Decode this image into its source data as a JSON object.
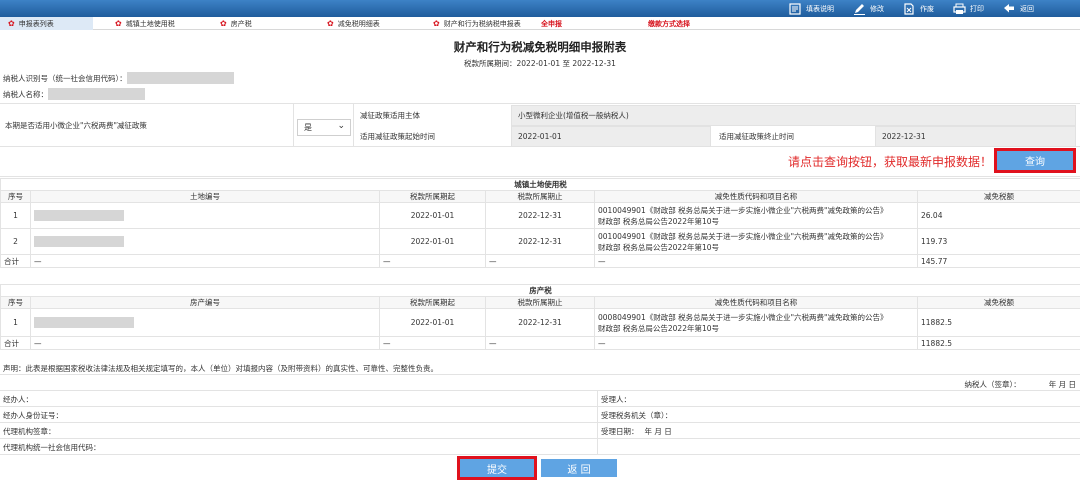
{
  "toolbar": {
    "items": [
      {
        "label": "填表说明",
        "icon": "form-guide-icon"
      },
      {
        "label": "修改",
        "icon": "edit-pen-icon"
      },
      {
        "label": "作废",
        "icon": "void-document-icon"
      },
      {
        "label": "打印",
        "icon": "printer-icon"
      },
      {
        "label": "返回",
        "icon": "back-arrow-icon"
      }
    ],
    "color": "#2d6fb3"
  },
  "tabs": [
    {
      "label": "申报表列表",
      "active": true
    },
    {
      "label": "城镇土地使用税"
    },
    {
      "label": "房产税"
    },
    {
      "label": "减免税明细表"
    },
    {
      "label": "财产和行为税纳税申报表"
    },
    {
      "label": "全申报",
      "red": true
    },
    {
      "label": "缴款方式选择",
      "red": true
    }
  ],
  "form": {
    "title": "财产和行为税减免税明细申报附表",
    "period_label": "税款所属期间：",
    "period_value": "2022-01-01 至 2022-12-31",
    "taxpayer_id_label": "纳税人识别号（统一社会信用代码）：",
    "taxpayer_name_label": "纳税人名称："
  },
  "policy": {
    "question": "本期是否适用小微企业\"六税两费\"减征政策",
    "selected": "是",
    "subject_label": "减征政策适用主体",
    "subject_value": "小型微利企业(增值税一般纳税人)",
    "start_label": "适用减征政策起始时间",
    "start_value": "2022-01-01",
    "end_label": "适用减征政策终止时间",
    "end_value": "2022-12-31"
  },
  "query": {
    "hint": "请点击查询按钮，获取最新申报数据！",
    "button": "查询"
  },
  "land_tax": {
    "section": "城镇土地使用税",
    "headers": [
      "序号",
      "土地编号",
      "税款所属期起",
      "税款所属期止",
      "减免性质代码和项目名称",
      "减免税额"
    ],
    "rows": [
      {
        "no": "1",
        "start": "2022-01-01",
        "end": "2022-12-31",
        "code_line1": "0010049901《财政部 税务总局关于进一步实施小微企业\"六税两费\"减免政策的公告》",
        "code_line2": "财政部 税务总局公告2022年第10号",
        "amount": "26.04"
      },
      {
        "no": "2",
        "start": "2022-01-01",
        "end": "2022-12-31",
        "code_line1": "0010049901《财政部 税务总局关于进一步实施小微企业\"六税两费\"减免政策的公告》",
        "code_line2": "财政部 税务总局公告2022年第10号",
        "amount": "119.73"
      }
    ],
    "total_label": "合计",
    "dash": "—",
    "total": "145.77"
  },
  "property_tax": {
    "section": "房产税",
    "headers": [
      "序号",
      "房产编号",
      "税款所属期起",
      "税款所属期止",
      "减免性质代码和项目名称",
      "减免税额"
    ],
    "rows": [
      {
        "no": "1",
        "start": "2022-01-01",
        "end": "2022-12-31",
        "code_line1": "0008049901《财政部 税务总局关于进一步实施小微企业\"六税两费\"减免政策的公告》",
        "code_line2": "财政部 税务总局公告2022年第10号",
        "amount": "11882.5"
      }
    ],
    "total_label": "合计",
    "dash": "—",
    "total": "11882.5"
  },
  "declaration": "声明：此表是根据国家税收法律法规及相关规定填写的，本人（单位）对填报内容（及附带资料）的真实性、可靠性、完整性负责。",
  "signature": {
    "taxpayer_sign": "纳税人（签章）：",
    "date": "年  月  日",
    "handler": "经办人：",
    "handler_id": "经办人身份证号：",
    "agency_sign": "代理机构签章：",
    "agency_code": "代理机构统一社会信用代码：",
    "receiver": "受理人：",
    "receiving_office": "受理税务机关（章）：",
    "receive_date_label": "受理日期：",
    "receive_date": "年  月  日"
  },
  "actions": {
    "submit": "提交",
    "back": "返 回"
  }
}
